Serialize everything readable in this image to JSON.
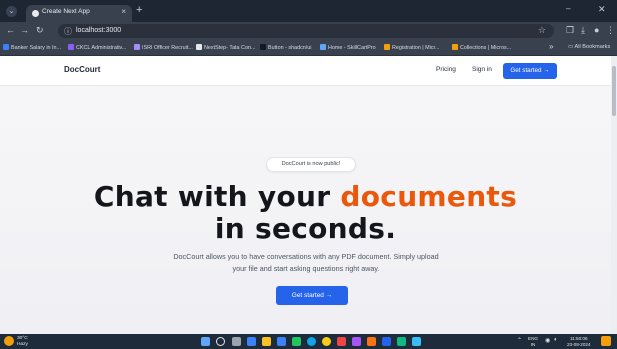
{
  "browser": {
    "tab_title": "Create Next App",
    "tab_close": "×",
    "new_tab": "+",
    "url": "localhost:3000",
    "bookmarks": [
      {
        "label": "Banker Salary in In...",
        "color": "#3b82f6"
      },
      {
        "label": "CKCL Administrativ...",
        "color": "#8b5cf6"
      },
      {
        "label": "ISRI Officer Recruit...",
        "color": "#a78bfa"
      },
      {
        "label": "NextStep- Tata Con...",
        "color": "#e5e7eb"
      },
      {
        "label": "Button - shadcn/ui",
        "color": "#111827"
      },
      {
        "label": "Home - SkillCartPro",
        "color": "#60a5fa"
      },
      {
        "label": "Registration | Micr...",
        "color": "#f59e0b"
      },
      {
        "label": "Collections | Micros...",
        "color": "#f59e0b"
      }
    ],
    "bookmarks_more": "»",
    "all_bookmarks": "All Bookmarks"
  },
  "site": {
    "brand": "DocCourt",
    "nav": {
      "pricing": "Pricing",
      "sign_in": "Sign in",
      "get_started": "Get started →"
    },
    "announcement": "DocCourt is now public!",
    "headline": {
      "part1": "Chat with your ",
      "highlight": "documents",
      "part2": "in seconds."
    },
    "subtext": "DocCourt allows you to have conversations with any PDF document. Simply upload your file and start asking questions right away.",
    "cta": "Get started →",
    "accent_color": "#ea580c",
    "primary_color": "#2563eb"
  },
  "taskbar": {
    "weather_temp": "30°C",
    "weather_desc": "Hazy",
    "tray_lang_top": "ENG",
    "tray_lang_bottom": "IN",
    "time": "11:50:06",
    "date": "23-08-2024"
  }
}
